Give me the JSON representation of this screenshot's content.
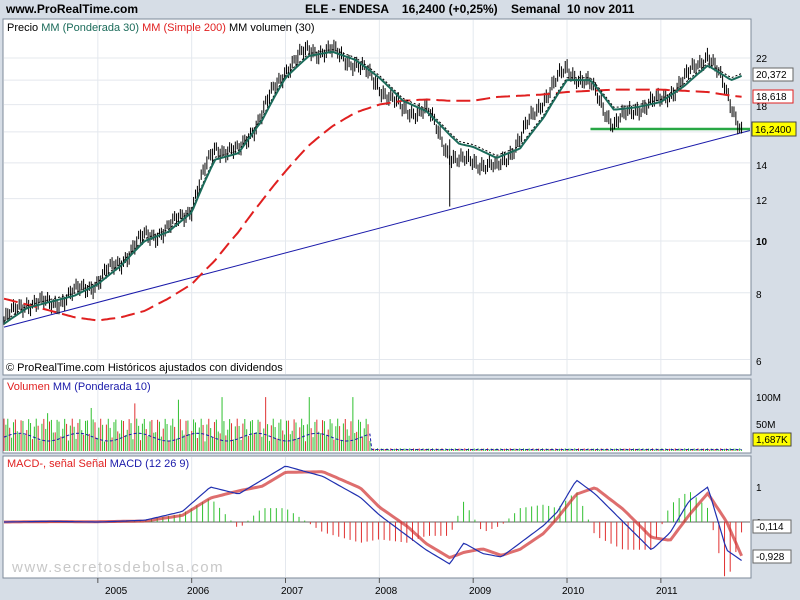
{
  "header": {
    "site": "www.ProRealTime.com",
    "ticker": "ELE - ENDESA",
    "price_change": "16,2400 (+0,25%)",
    "period": "Semanal",
    "date": "10 nov 2011"
  },
  "colors": {
    "background": "#d6dde6",
    "panel": "#ffffff",
    "price_bar": "#000000",
    "wma30": "#1b6b5a",
    "sma200": "#e02020",
    "volume_ma": "#000000",
    "trend_line": "#1a1aaa",
    "support_line": "#28a745",
    "vol_up": "#30c030",
    "vol_down": "#e03030",
    "macd": "#2030b0",
    "signal": "#d03030",
    "hist_pos": "#30c030",
    "hist_neg": "#e03030",
    "last_price_label": "#ffff00"
  },
  "main_panel": {
    "legend": {
      "price": "Precio",
      "wma": "MM (Ponderada 30)",
      "sma": "MM (Simple 200)",
      "vol": "MM volumen (30)"
    },
    "footer_note": "© ProRealTime.com Históricos ajustados con dividendos",
    "y_ticks": [
      "22",
      "20",
      "18",
      "16",
      "14",
      "12",
      "10",
      "8",
      "6"
    ],
    "right_labels": {
      "wma": "20,372",
      "sma": "18,618",
      "last": "16,2400"
    }
  },
  "volume_panel": {
    "legend": {
      "vol": "Volumen",
      "ma": "MM (Ponderada 10)"
    },
    "y_ticks": [
      "100M",
      "50M"
    ],
    "last_label": "1,687K"
  },
  "macd_panel": {
    "legend": {
      "macd_signal": "MACD-, señal Señal",
      "macd": "MACD (12 26 9)"
    },
    "y_ticks": [
      "1",
      "0",
      "-1"
    ],
    "right_labels": {
      "macd": "-0,114",
      "signal": "-0,928"
    },
    "watermark": "www.secretosdebolsa.com"
  },
  "x_axis": {
    "labels": [
      "2005",
      "2006",
      "2007",
      "2008",
      "2009",
      "2010",
      "2011"
    ]
  },
  "chart_data": {
    "type": "line",
    "title": "ELE - ENDESA 16,2400 (+0,25%) Semanal 10 nov 2011",
    "scale": "log",
    "ylim": [
      5.5,
      24
    ],
    "x": [
      2004.0,
      2004.25,
      2004.5,
      2004.75,
      2005.0,
      2005.25,
      2005.5,
      2005.75,
      2006.0,
      2006.25,
      2006.5,
      2006.75,
      2007.0,
      2007.25,
      2007.5,
      2007.75,
      2008.0,
      2008.25,
      2008.5,
      2008.75,
      2008.85,
      2009.0,
      2009.25,
      2009.5,
      2009.75,
      2010.0,
      2010.25,
      2010.5,
      2010.75,
      2011.0,
      2011.25,
      2011.5,
      2011.75,
      2011.86
    ],
    "series": [
      {
        "name": "Precio",
        "values": [
          7.1,
          7.7,
          7.6,
          8.0,
          8.4,
          9.2,
          10.2,
          10.5,
          11.6,
          15.0,
          14.6,
          17.3,
          21.0,
          22.8,
          22.6,
          21.5,
          19.5,
          17.5,
          17.6,
          14.5,
          14.0,
          14.2,
          13.6,
          15.5,
          18.5,
          21.0,
          19.5,
          16.5,
          17.8,
          18.3,
          20.0,
          22.5,
          18.0,
          16.24
        ]
      },
      {
        "name": "MM (Ponderada 30)",
        "values": [
          7.0,
          7.5,
          7.7,
          7.9,
          8.3,
          9.0,
          10.0,
          10.4,
          11.3,
          14.2,
          14.6,
          16.8,
          20.2,
          22.2,
          22.6,
          21.8,
          20.2,
          18.3,
          17.5,
          15.8,
          15.2,
          15.0,
          14.3,
          14.9,
          17.0,
          20.0,
          20.0,
          17.6,
          17.8,
          18.2,
          19.5,
          21.3,
          20.0,
          20.372
        ]
      },
      {
        "name": "MM (Simple 200)",
        "values": [
          7.8,
          7.6,
          7.4,
          7.2,
          7.1,
          7.2,
          7.4,
          7.8,
          8.3,
          9.2,
          10.4,
          11.9,
          13.5,
          15.1,
          16.4,
          17.4,
          18.0,
          18.3,
          18.4,
          18.3,
          18.3,
          18.3,
          18.6,
          18.7,
          18.8,
          19.0,
          19.1,
          19.2,
          19.2,
          19.2,
          19.1,
          19.0,
          18.7,
          18.618
        ]
      }
    ]
  }
}
